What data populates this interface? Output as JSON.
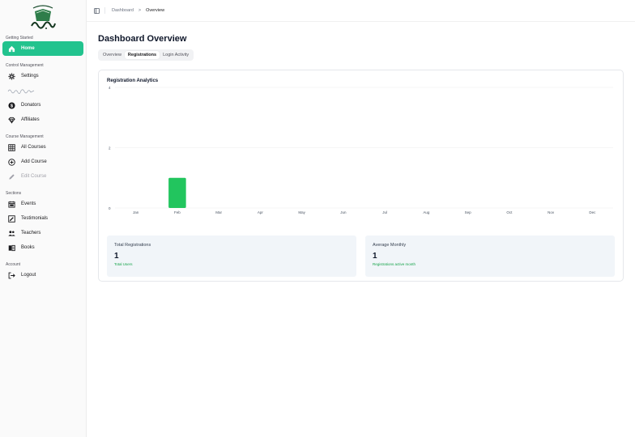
{
  "sidebar": {
    "sections": [
      {
        "title": "Getting Started",
        "items": [
          {
            "label": "Home",
            "icon": "home-icon",
            "state": "active"
          }
        ]
      },
      {
        "title": "Control Management",
        "items": [
          {
            "label": "Settings",
            "icon": "gear-icon",
            "state": "normal"
          },
          {
            "label": "",
            "icon": "",
            "state": "scribble"
          },
          {
            "label": "Donators",
            "icon": "dollar-icon",
            "state": "normal"
          },
          {
            "label": "Affiliates",
            "icon": "diamond-icon",
            "state": "normal"
          }
        ]
      },
      {
        "title": "Course Management",
        "items": [
          {
            "label": "All Courses",
            "icon": "grid-icon",
            "state": "normal"
          },
          {
            "label": "Add Course",
            "icon": "plus-circle-icon",
            "state": "normal"
          },
          {
            "label": "Edit Course",
            "icon": "pencil-icon",
            "state": "disabled"
          }
        ]
      },
      {
        "title": "Sections",
        "items": [
          {
            "label": "Events",
            "icon": "calendar-icon",
            "state": "normal"
          },
          {
            "label": "Testimonials",
            "icon": "quote-icon",
            "state": "normal"
          },
          {
            "label": "Teachers",
            "icon": "users-icon",
            "state": "normal"
          },
          {
            "label": "Books",
            "icon": "book-icon",
            "state": "normal"
          }
        ]
      },
      {
        "title": "Account",
        "items": [
          {
            "label": "Logout",
            "icon": "logout-icon",
            "state": "normal"
          }
        ]
      }
    ]
  },
  "topbar": {
    "crumbs": [
      "Dashboard",
      "Overview"
    ],
    "separator": ">"
  },
  "page": {
    "title": "Dashboard Overview",
    "tabs": [
      {
        "label": "Overview",
        "active": false
      },
      {
        "label": "Registrations",
        "active": true
      },
      {
        "label": "Login Activity",
        "active": false
      }
    ]
  },
  "card": {
    "title": "Registration Analytics"
  },
  "chart_data": {
    "type": "bar",
    "title": "Registration Analytics",
    "categories": [
      "Jan",
      "Feb",
      "Mar",
      "Apr",
      "May",
      "Jun",
      "Jul",
      "Aug",
      "Sep",
      "Oct",
      "Nov",
      "Dec"
    ],
    "values": [
      0,
      1,
      0,
      0,
      0,
      0,
      0,
      0,
      0,
      0,
      0,
      0
    ],
    "yticks": [
      0,
      2,
      4
    ],
    "ylim": [
      0,
      4
    ],
    "grid": true,
    "bar_color": "#22c55e"
  },
  "stats": [
    {
      "label": "Total Registrations",
      "value": "1",
      "sub": "Total Users"
    },
    {
      "label": "Average Monthly",
      "value": "1",
      "sub": "Registrations active month"
    }
  ],
  "colors": {
    "accent": "#22c38e",
    "stat_bg": "#f1f5f9",
    "success_text": "#16a34a"
  }
}
